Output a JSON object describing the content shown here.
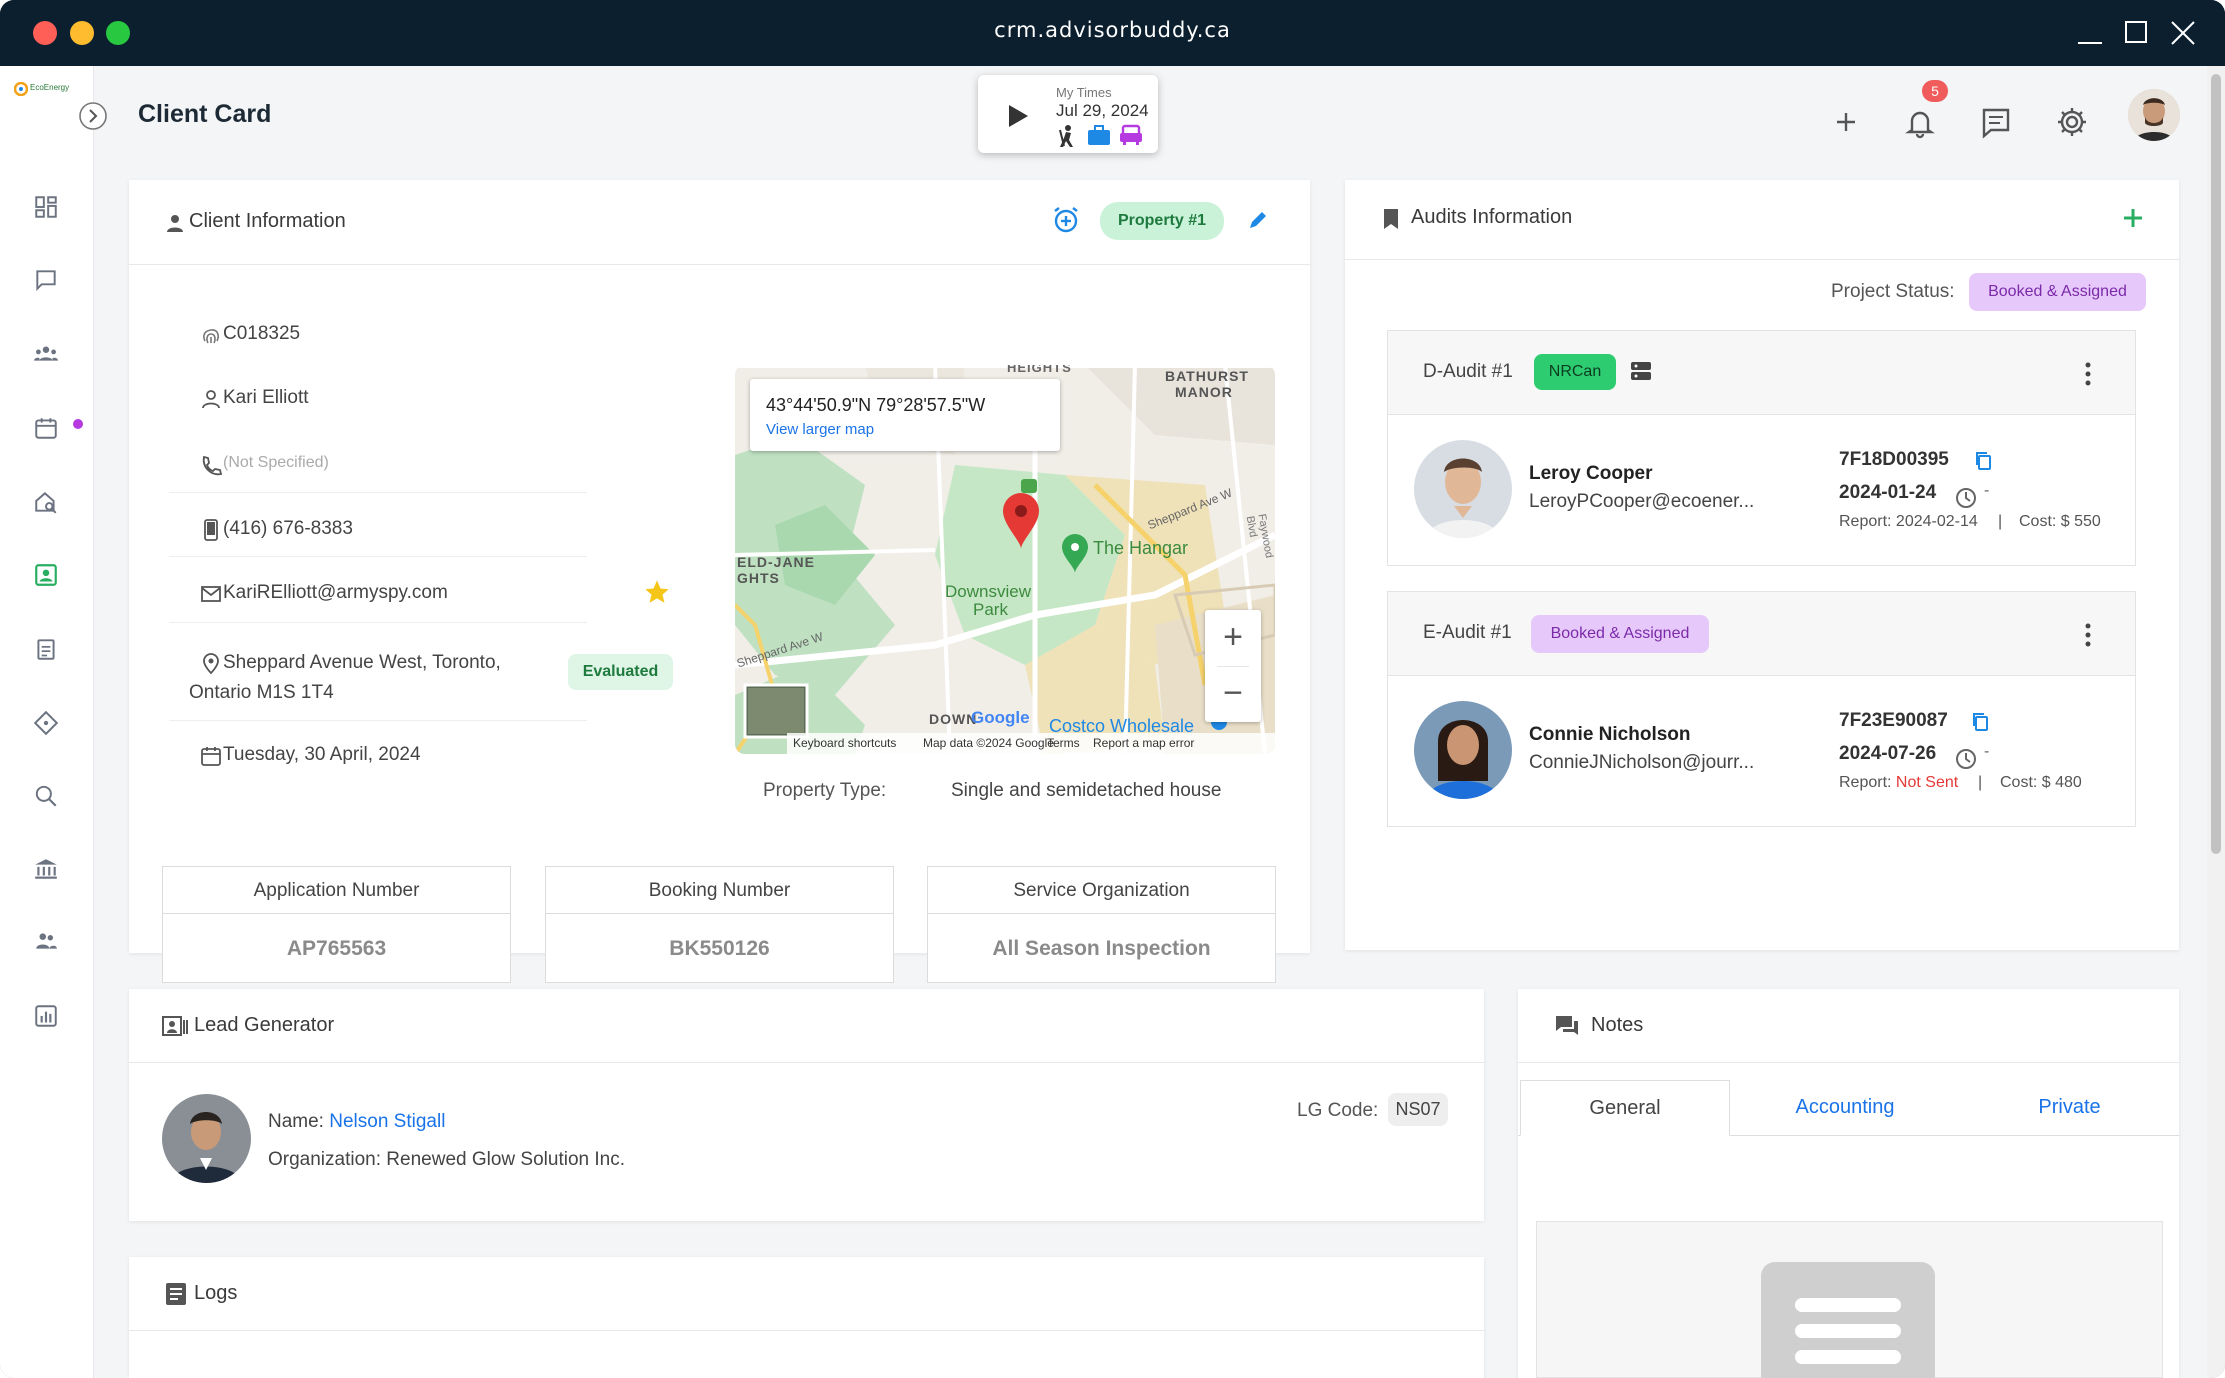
{
  "window": {
    "title": "crm.advisorbuddy.ca"
  },
  "app": {
    "logo_text": "EcoEnergy",
    "page_title": "Client Card"
  },
  "timer": {
    "label": "My Times",
    "date": "Jul 29, 2024"
  },
  "header": {
    "notifications_count": "5"
  },
  "client": {
    "section_title": "Client Information",
    "property_badge": "Property #1",
    "id": "C018325",
    "name": "Kari Elliott",
    "phone": "(Not Specified)",
    "mobile": "(416) 676-8383",
    "email": "KariRElliott@armyspy.com",
    "address_line1": "Sheppard Avenue West, Toronto,",
    "address_line2": "Ontario M1S 1T4",
    "status_badge": "Evaluated",
    "date": "Tuesday, 30 April, 2024",
    "property_type_label": "Property Type:",
    "property_type_value": "Single and semidetached house",
    "application_number_label": "Application Number",
    "application_number": "AP765563",
    "booking_number_label": "Booking Number",
    "booking_number": "BK550126",
    "service_org_label": "Service Organization",
    "service_org": "All Season Inspection"
  },
  "map": {
    "coords": "43°44'50.9\"N 79°28'57.5\"W",
    "view_larger": "View larger map",
    "labels": {
      "bathurst1": "BATHURST",
      "bathurst2": "MANOR",
      "heights": "HEIGHTS",
      "eldjane1": "ELD-JANE",
      "eldjane2": "GHTS",
      "downsview1": "Downsview",
      "downsview2": "Park",
      "hangar": "The Hangar",
      "sheppard1": "Sheppard Ave W",
      "sheppard2": "Sheppard Ave W",
      "faywood": "Faywood Blvd",
      "costco": "Costco Wholesale",
      "down": "DOWN",
      "google": "Google"
    },
    "footer": {
      "shortcuts": "Keyboard shortcuts",
      "data": "Map data ©2024 Google",
      "terms": "Terms",
      "report": "Report a map error"
    },
    "zoom_in": "+",
    "zoom_out": "−"
  },
  "audits": {
    "section_title": "Audits Information",
    "project_status_label": "Project Status:",
    "project_status": "Booked & Assigned",
    "items": [
      {
        "title": "D-Audit #1",
        "badge": "NRCan",
        "person": "Leroy Cooper",
        "email": "LeroyPCooper@ecoener...",
        "code": "7F18D00395",
        "date": "2024-01-24",
        "dash": "-",
        "report_label": "Report:",
        "report_value": "2024-02-14",
        "sep": "|",
        "cost": "Cost: $ 550"
      },
      {
        "title": "E-Audit #1",
        "badge": "Booked & Assigned",
        "person": "Connie Nicholson",
        "email": "ConnieJNicholson@jourr...",
        "code": "7F23E90087",
        "date": "2024-07-26",
        "dash": "-",
        "report_label": "Report:",
        "report_value": "Not Sent",
        "sep": "|",
        "cost": "Cost: $ 480"
      }
    ]
  },
  "lead": {
    "section_title": "Lead Generator",
    "name_label": "Name:",
    "name": "Nelson Stigall",
    "org_label": "Organization:",
    "org": "Renewed Glow Solution Inc.",
    "code_label": "LG Code:",
    "code": "NS07"
  },
  "notes": {
    "section_title": "Notes",
    "tabs": [
      "General",
      "Accounting",
      "Private"
    ]
  },
  "logs": {
    "section_title": "Logs"
  },
  "colors": {
    "accent": "#1e88e5",
    "green_badge": "#c9f2d9",
    "purple_badge": "#e6c8fb",
    "titlebar": "#0b1f2e"
  }
}
